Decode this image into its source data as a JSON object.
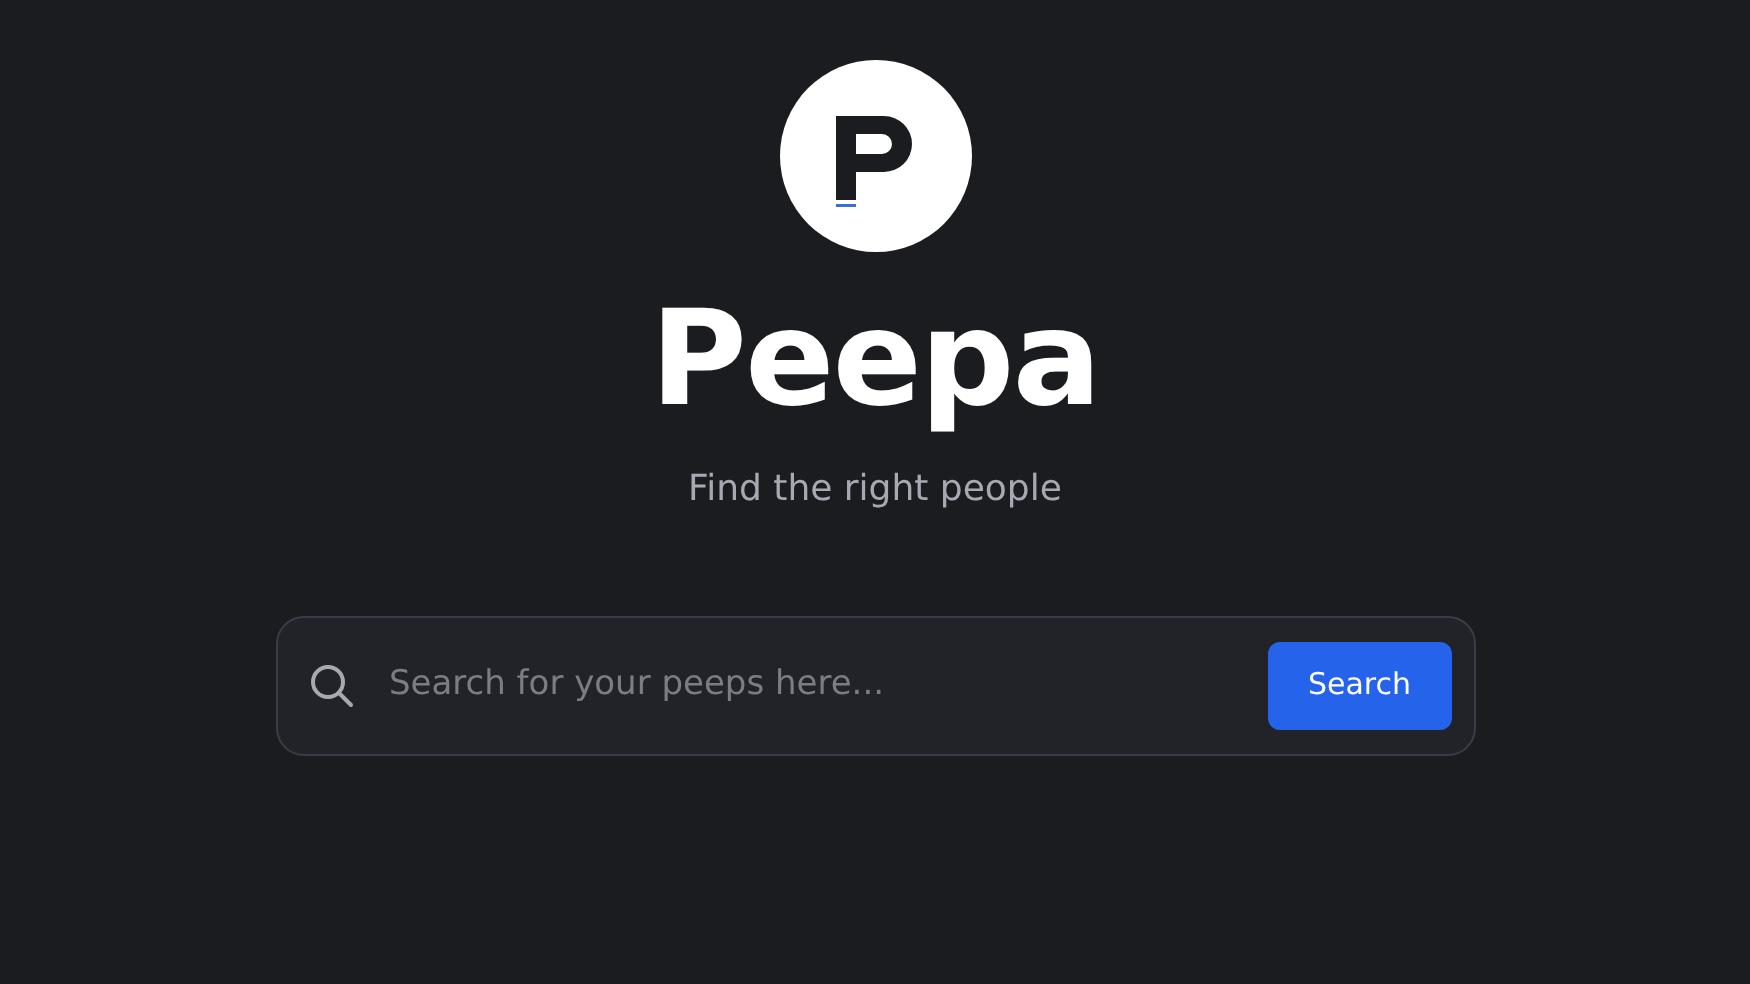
{
  "brand": {
    "name": "Peepa",
    "tagline": "Find the right people"
  },
  "search": {
    "placeholder": "Search for your peeps here...",
    "button": "Search"
  }
}
